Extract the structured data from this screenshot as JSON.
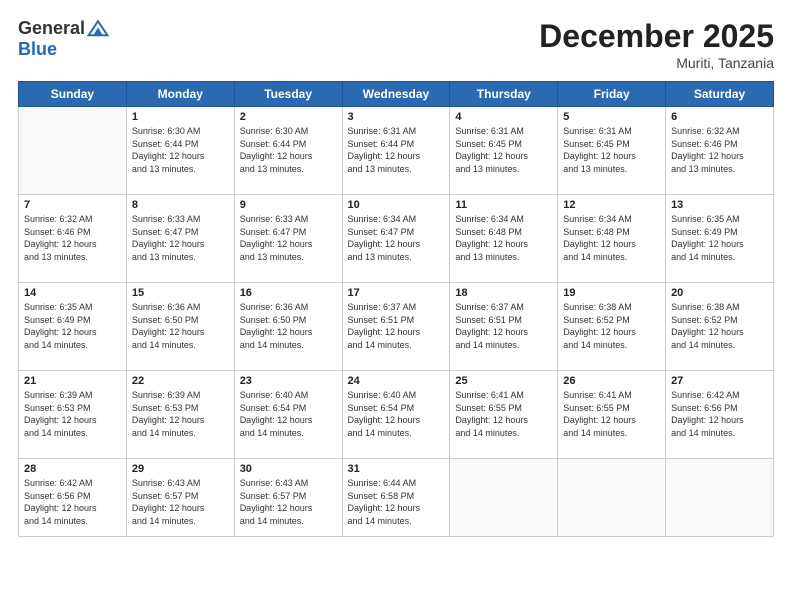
{
  "header": {
    "logo_general": "General",
    "logo_blue": "Blue",
    "month_title": "December 2025",
    "location": "Muriti, Tanzania"
  },
  "days_of_week": [
    "Sunday",
    "Monday",
    "Tuesday",
    "Wednesday",
    "Thursday",
    "Friday",
    "Saturday"
  ],
  "weeks": [
    [
      {
        "day": "",
        "info": ""
      },
      {
        "day": "1",
        "info": "Sunrise: 6:30 AM\nSunset: 6:44 PM\nDaylight: 12 hours\nand 13 minutes."
      },
      {
        "day": "2",
        "info": "Sunrise: 6:30 AM\nSunset: 6:44 PM\nDaylight: 12 hours\nand 13 minutes."
      },
      {
        "day": "3",
        "info": "Sunrise: 6:31 AM\nSunset: 6:44 PM\nDaylight: 12 hours\nand 13 minutes."
      },
      {
        "day": "4",
        "info": "Sunrise: 6:31 AM\nSunset: 6:45 PM\nDaylight: 12 hours\nand 13 minutes."
      },
      {
        "day": "5",
        "info": "Sunrise: 6:31 AM\nSunset: 6:45 PM\nDaylight: 12 hours\nand 13 minutes."
      },
      {
        "day": "6",
        "info": "Sunrise: 6:32 AM\nSunset: 6:46 PM\nDaylight: 12 hours\nand 13 minutes."
      }
    ],
    [
      {
        "day": "7",
        "info": "Sunrise: 6:32 AM\nSunset: 6:46 PM\nDaylight: 12 hours\nand 13 minutes."
      },
      {
        "day": "8",
        "info": "Sunrise: 6:33 AM\nSunset: 6:47 PM\nDaylight: 12 hours\nand 13 minutes."
      },
      {
        "day": "9",
        "info": "Sunrise: 6:33 AM\nSunset: 6:47 PM\nDaylight: 12 hours\nand 13 minutes."
      },
      {
        "day": "10",
        "info": "Sunrise: 6:34 AM\nSunset: 6:47 PM\nDaylight: 12 hours\nand 13 minutes."
      },
      {
        "day": "11",
        "info": "Sunrise: 6:34 AM\nSunset: 6:48 PM\nDaylight: 12 hours\nand 13 minutes."
      },
      {
        "day": "12",
        "info": "Sunrise: 6:34 AM\nSunset: 6:48 PM\nDaylight: 12 hours\nand 14 minutes."
      },
      {
        "day": "13",
        "info": "Sunrise: 6:35 AM\nSunset: 6:49 PM\nDaylight: 12 hours\nand 14 minutes."
      }
    ],
    [
      {
        "day": "14",
        "info": "Sunrise: 6:35 AM\nSunset: 6:49 PM\nDaylight: 12 hours\nand 14 minutes."
      },
      {
        "day": "15",
        "info": "Sunrise: 6:36 AM\nSunset: 6:50 PM\nDaylight: 12 hours\nand 14 minutes."
      },
      {
        "day": "16",
        "info": "Sunrise: 6:36 AM\nSunset: 6:50 PM\nDaylight: 12 hours\nand 14 minutes."
      },
      {
        "day": "17",
        "info": "Sunrise: 6:37 AM\nSunset: 6:51 PM\nDaylight: 12 hours\nand 14 minutes."
      },
      {
        "day": "18",
        "info": "Sunrise: 6:37 AM\nSunset: 6:51 PM\nDaylight: 12 hours\nand 14 minutes."
      },
      {
        "day": "19",
        "info": "Sunrise: 6:38 AM\nSunset: 6:52 PM\nDaylight: 12 hours\nand 14 minutes."
      },
      {
        "day": "20",
        "info": "Sunrise: 6:38 AM\nSunset: 6:52 PM\nDaylight: 12 hours\nand 14 minutes."
      }
    ],
    [
      {
        "day": "21",
        "info": "Sunrise: 6:39 AM\nSunset: 6:53 PM\nDaylight: 12 hours\nand 14 minutes."
      },
      {
        "day": "22",
        "info": "Sunrise: 6:39 AM\nSunset: 6:53 PM\nDaylight: 12 hours\nand 14 minutes."
      },
      {
        "day": "23",
        "info": "Sunrise: 6:40 AM\nSunset: 6:54 PM\nDaylight: 12 hours\nand 14 minutes."
      },
      {
        "day": "24",
        "info": "Sunrise: 6:40 AM\nSunset: 6:54 PM\nDaylight: 12 hours\nand 14 minutes."
      },
      {
        "day": "25",
        "info": "Sunrise: 6:41 AM\nSunset: 6:55 PM\nDaylight: 12 hours\nand 14 minutes."
      },
      {
        "day": "26",
        "info": "Sunrise: 6:41 AM\nSunset: 6:55 PM\nDaylight: 12 hours\nand 14 minutes."
      },
      {
        "day": "27",
        "info": "Sunrise: 6:42 AM\nSunset: 6:56 PM\nDaylight: 12 hours\nand 14 minutes."
      }
    ],
    [
      {
        "day": "28",
        "info": "Sunrise: 6:42 AM\nSunset: 6:56 PM\nDaylight: 12 hours\nand 14 minutes."
      },
      {
        "day": "29",
        "info": "Sunrise: 6:43 AM\nSunset: 6:57 PM\nDaylight: 12 hours\nand 14 minutes."
      },
      {
        "day": "30",
        "info": "Sunrise: 6:43 AM\nSunset: 6:57 PM\nDaylight: 12 hours\nand 14 minutes."
      },
      {
        "day": "31",
        "info": "Sunrise: 6:44 AM\nSunset: 6:58 PM\nDaylight: 12 hours\nand 14 minutes."
      },
      {
        "day": "",
        "info": ""
      },
      {
        "day": "",
        "info": ""
      },
      {
        "day": "",
        "info": ""
      }
    ]
  ]
}
